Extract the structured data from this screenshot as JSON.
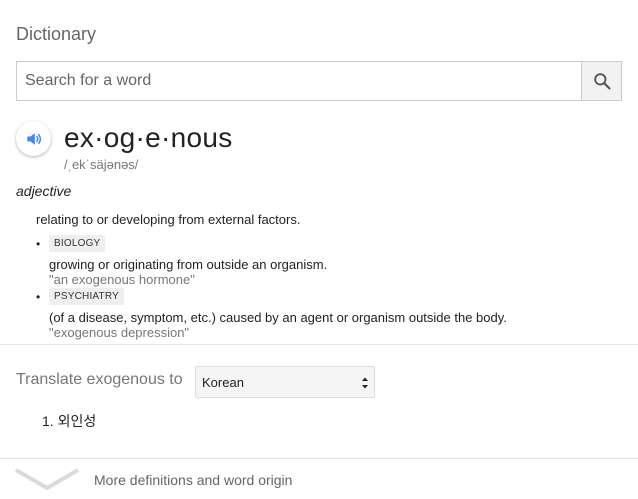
{
  "title": "Dictionary",
  "search": {
    "placeholder": "Search for a word",
    "value": ""
  },
  "entry": {
    "word": "ex·og·e·nous",
    "phonetic": "/ˌekˈsäjənəs/",
    "part_of_speech": "adjective",
    "main_definition": "relating to or developing from external factors.",
    "senses": [
      {
        "tag": "BIOLOGY",
        "definition": "growing or originating from outside an organism.",
        "example": "\"an exogenous hormone\""
      },
      {
        "tag": "PSYCHIATRY",
        "definition": "(of a disease, symptom, etc.) caused by an agent or organism outside the body.",
        "example": "\"exogenous depression\""
      }
    ]
  },
  "translate": {
    "label": "Translate exogenous to",
    "selected_language": "Korean",
    "results": [
      "1. 외인성"
    ]
  },
  "footer": {
    "more_label": "More definitions and word origin"
  },
  "colors": {
    "accent": "#4285f4",
    "muted": "#777777"
  },
  "icons": {
    "search": "search-icon",
    "speaker": "speaker-icon",
    "more": "chevron-down-icon"
  }
}
